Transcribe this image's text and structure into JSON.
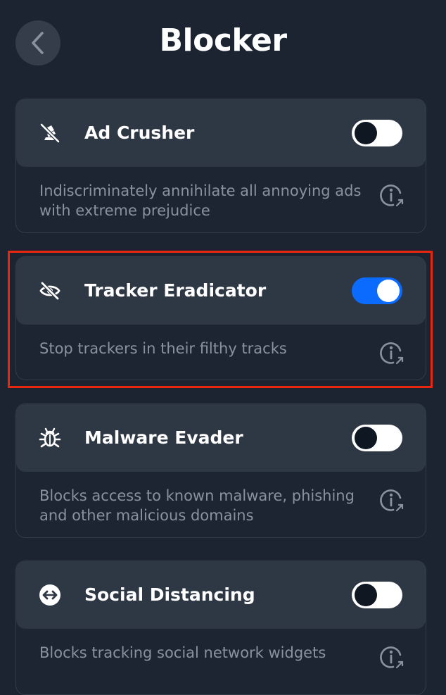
{
  "header": {
    "title": "Blocker"
  },
  "features": [
    {
      "title": "Ad Crusher",
      "description": "Indiscriminately annihilate all annoying ads with extreme prejudice",
      "enabled": false,
      "icon": "ad-crusher-icon"
    },
    {
      "title": "Tracker Eradicator",
      "description": "Stop trackers in their filthy tracks",
      "enabled": true,
      "icon": "eye-slash-icon"
    },
    {
      "title": "Malware Evader",
      "description": "Blocks access to known malware, phishing and other malicious domains",
      "enabled": false,
      "icon": "bug-icon"
    },
    {
      "title": "Social Distancing",
      "description": "Blocks tracking social network widgets",
      "enabled": false,
      "icon": "social-arrows-icon"
    }
  ],
  "colors": {
    "background": "#1c2431",
    "card_header": "#2e3744",
    "toggle_on": "#0b6bff",
    "highlight": "#e8250f",
    "description_text": "#8a929e"
  }
}
